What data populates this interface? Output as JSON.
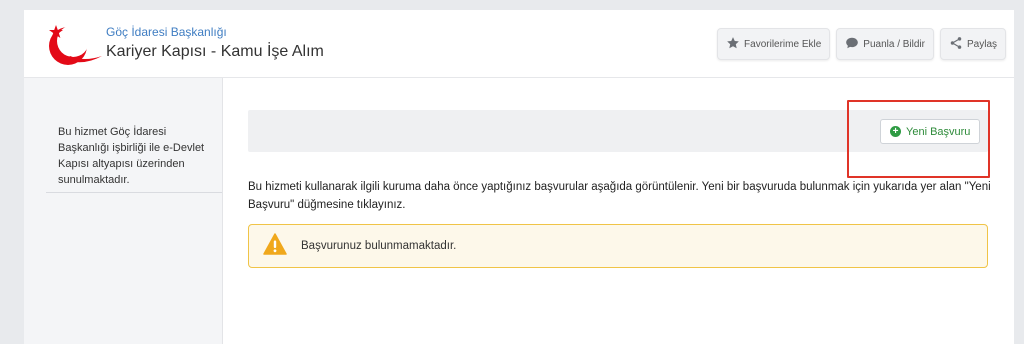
{
  "header": {
    "agency": "Göç İdaresi Başkanlığı",
    "service_title": "Kariyer Kapısı - Kamu İşe Alım",
    "actions": [
      {
        "label": "Favorilerime Ekle",
        "icon": "star-icon"
      },
      {
        "label": "Puanla / Bildir",
        "icon": "comment-icon"
      },
      {
        "label": "Paylaş",
        "icon": "share-icon"
      }
    ]
  },
  "sidebar": {
    "info": "Bu hizmet Göç İdaresi Başkanlığı işbirliği ile e-Devlet Kapısı altyapısı üzerinden sunulmaktadır."
  },
  "main": {
    "new_application_label": "Yeni Başvuru",
    "description": "Bu hizmeti kullanarak ilgili kuruma daha önce yaptığınız başvurular aşağıda görüntülenir. Yeni bir başvuruda bulunmak için yukarıda yer alan \"Yeni Başvuru\" düğmesine tıklayınız.",
    "alert_message": "Başvurunuz bulunmamaktadır."
  },
  "colors": {
    "accent_blue": "#3f7dc2",
    "logo_red": "#e30a17",
    "success_green": "#2e9b43",
    "warning_border": "#f0c447",
    "highlight_red": "#e03428"
  }
}
